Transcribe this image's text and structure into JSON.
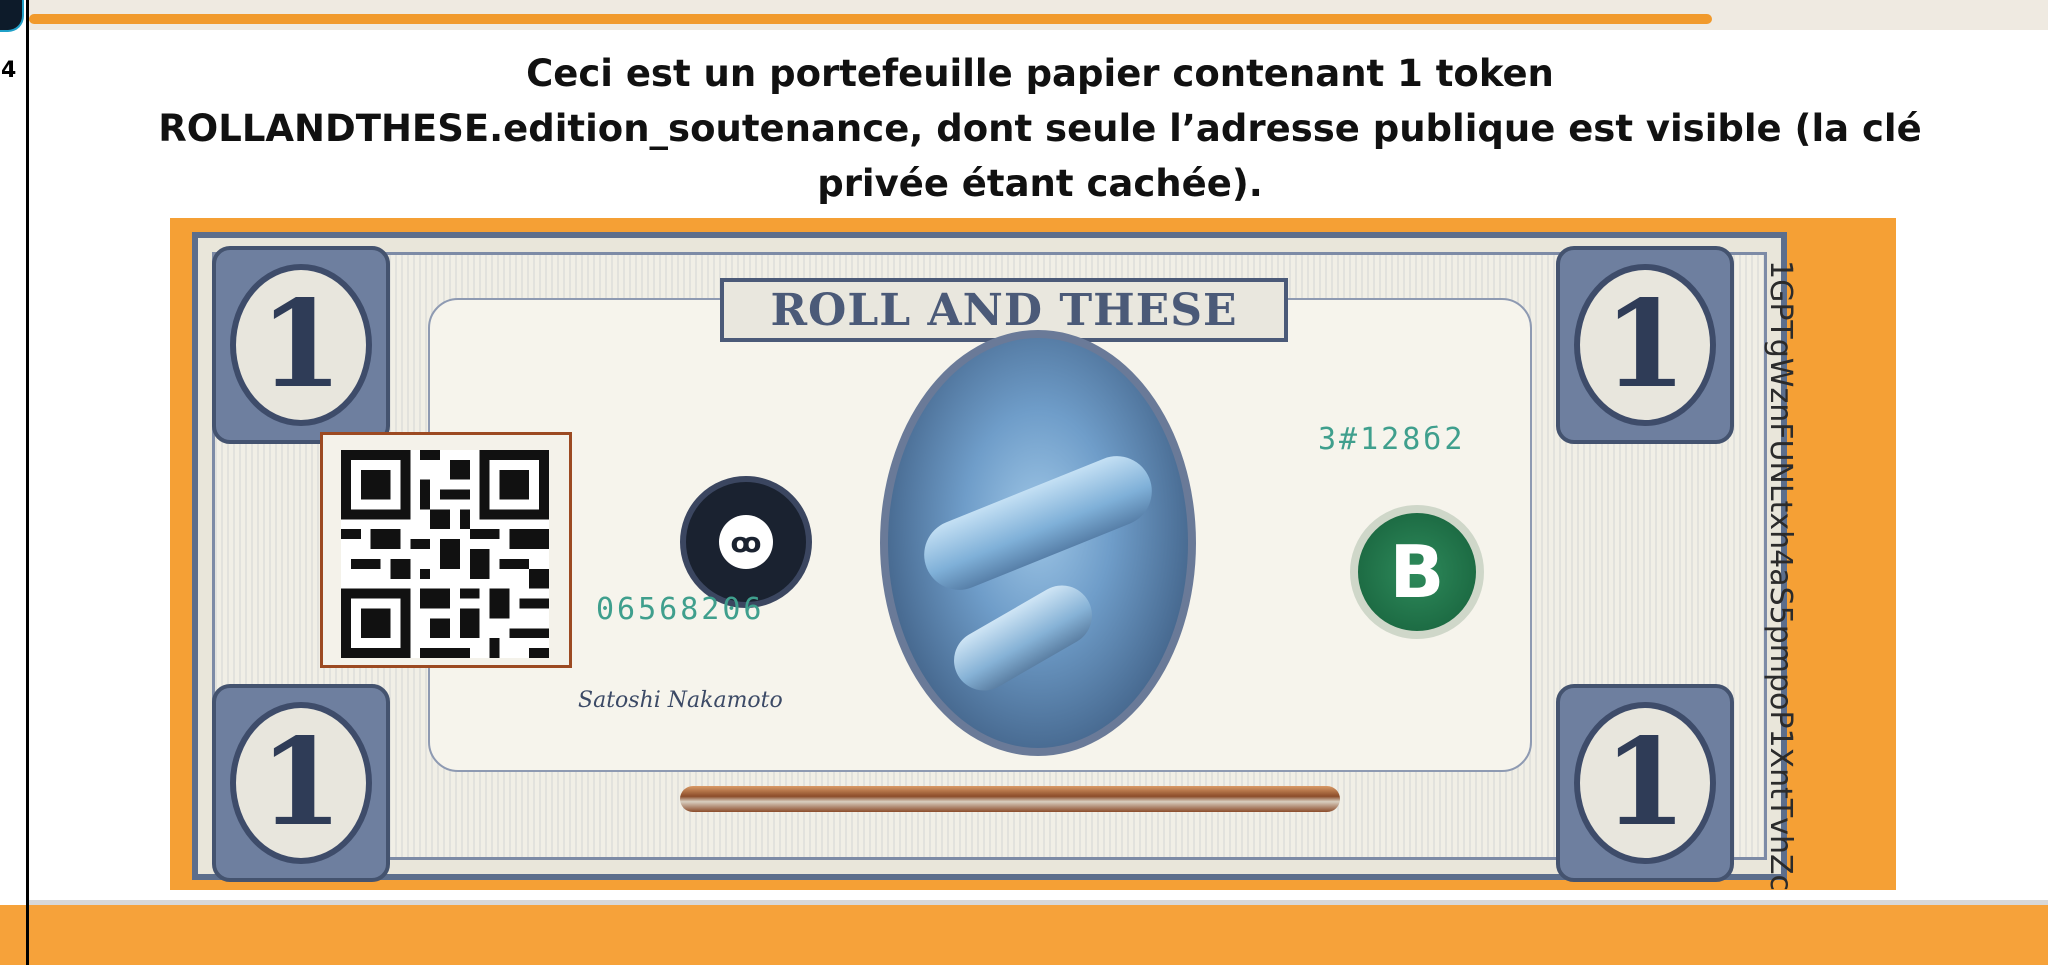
{
  "slide": {
    "number": "4",
    "heading_lines": [
      "Ceci est un portefeuille papier contenant 1 token",
      "ROLLANDTHESE.edition_soutenance, dont seule l’adresse publique est visible (la clé",
      "privée étant cachée)."
    ]
  },
  "bill": {
    "banner": "ROLL AND THESE",
    "corner_digit": "1",
    "serial_left": "06568206",
    "serial_right": "3#128б2",
    "signature": "Satoshi Nakamoto",
    "bitcoin_symbol": "B",
    "seal_symbol": "ꝏ",
    "public_address": "1GPTgWznFUNLtxh4aS5pmpoP1XntTvhZc"
  },
  "colors": {
    "accent_orange": "#f5a035",
    "bill_ink": "#4b5a78",
    "serial_green": "#3f9f8d",
    "bitcoin_green": "#1d6c44"
  },
  "icons": {
    "qr": "qr-code-icon",
    "bitcoin": "bitcoin-icon"
  }
}
